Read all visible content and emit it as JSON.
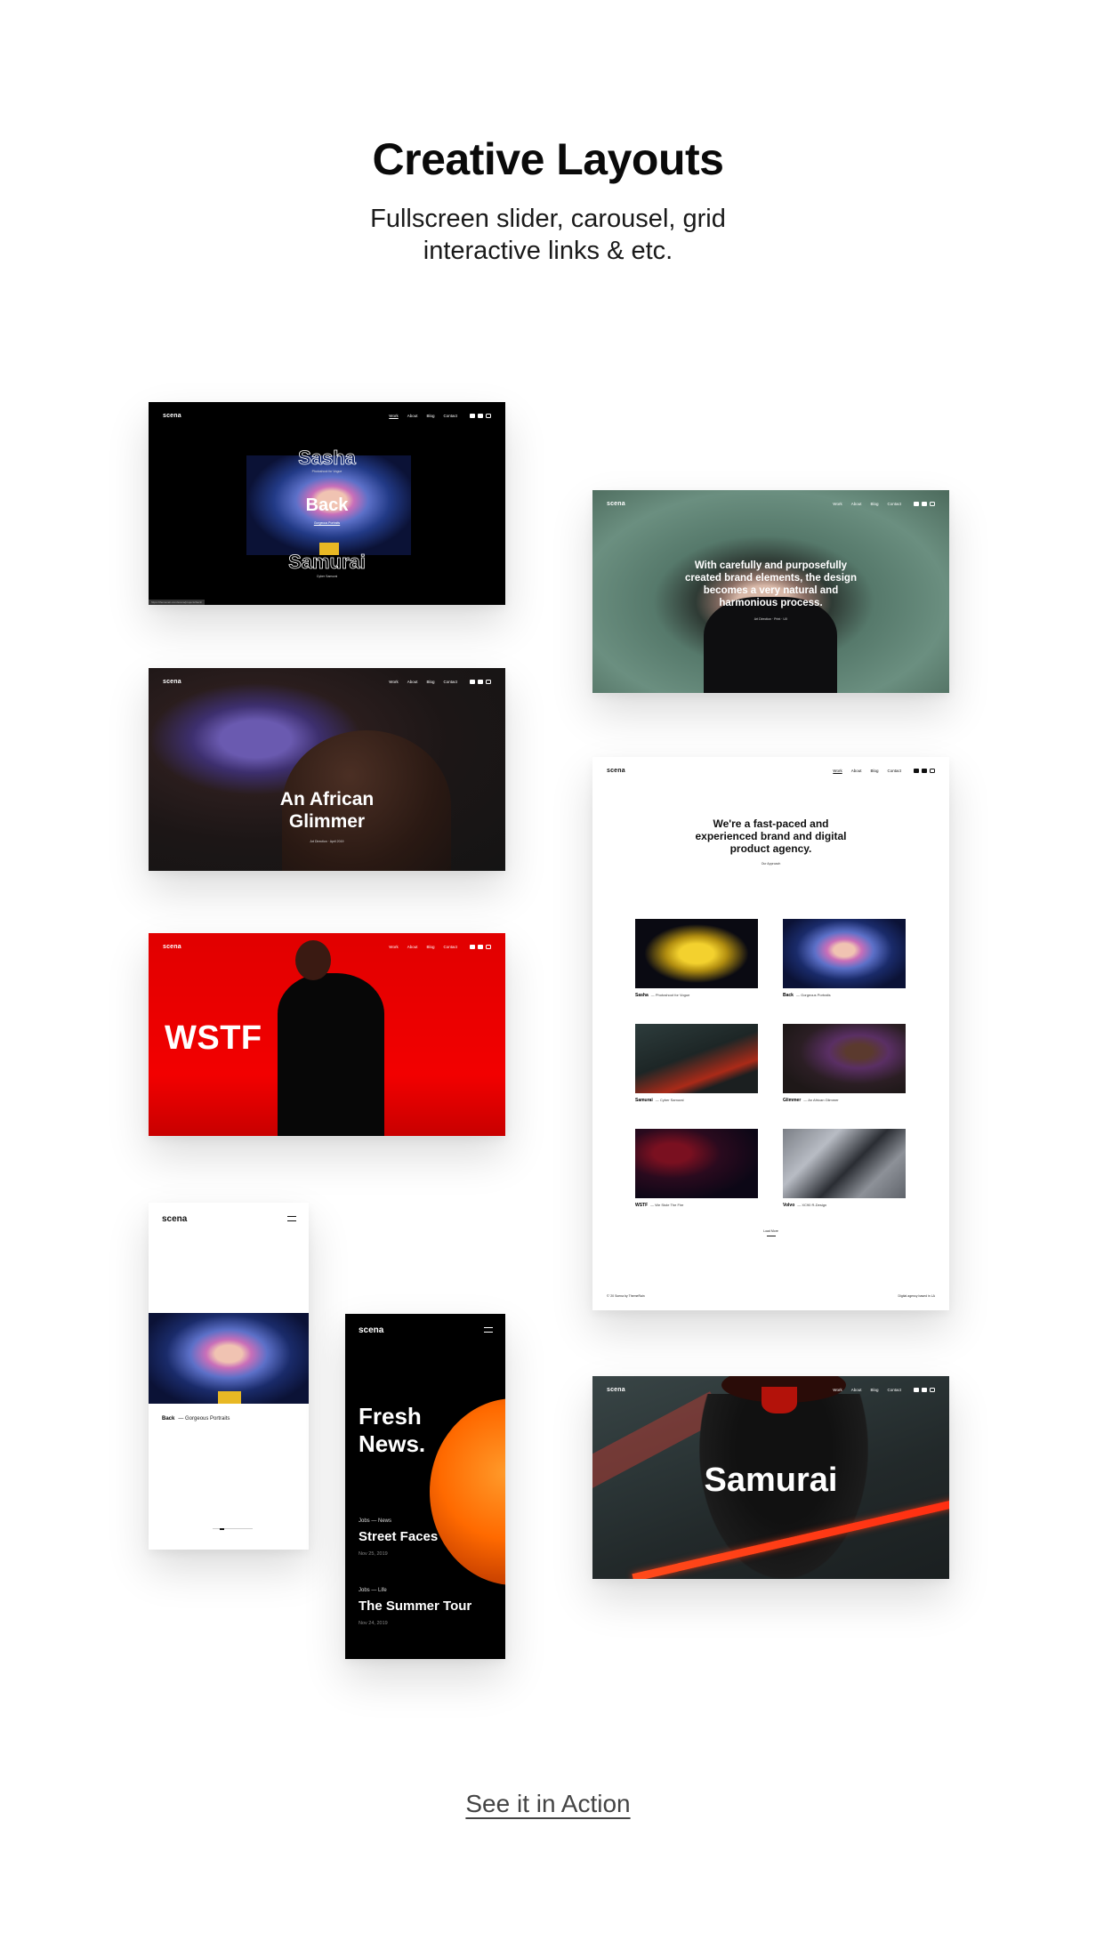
{
  "header": {
    "title": "Creative Layouts",
    "subtitle_lines": [
      "Fullscreen slider, carousel, grid",
      "interactive links & etc."
    ]
  },
  "brand": {
    "logo": "scena"
  },
  "nav": {
    "items": [
      "Work",
      "About",
      "Blog",
      "Contact"
    ],
    "social": [
      "twitter-icon",
      "youtube-icon",
      "instagram-icon"
    ]
  },
  "shots": {
    "slider": {
      "slides": [
        {
          "title": "Sasha",
          "subtitle": "Photoshoot for Vogue"
        },
        {
          "title": "Back",
          "subtitle": "Gorgeous Portraits"
        },
        {
          "title": "Samurai",
          "subtitle": "Cyber Samurai"
        }
      ],
      "status_url": "https://themerain.com/scena/projects/back/"
    },
    "quote": {
      "text": "With carefully and purposefully created brand elements, the design becomes a very natural and harmonious process.",
      "cite": "Art Direction · Print · UX"
    },
    "glimmer": {
      "title_lines": [
        "An African",
        "Glimmer"
      ],
      "meta": "Art Direction · April 2019"
    },
    "wstf": {
      "title": "WSTF"
    },
    "grid": {
      "headline": "We're a fast-paced and experienced brand and digital product agency.",
      "link": "Our Approach",
      "projects": [
        {
          "name": "Sasha",
          "desc": "Photoshoot for Vogue"
        },
        {
          "name": "Back",
          "desc": "Gorgeous Portraits"
        },
        {
          "name": "Samurai",
          "desc": "Cyber Samurai"
        },
        {
          "name": "Glimmer",
          "desc": "An African Glimmer"
        },
        {
          "name": "WSTF",
          "desc": "We Stole The Fire"
        },
        {
          "name": "Volvo",
          "desc": "XC90 R-Design"
        }
      ],
      "load_more": "Load More",
      "footer_left": "© '20 Scena by ThemeRain",
      "footer_right": "Digital agency based in LA"
    },
    "samurai": {
      "title": "Samurai"
    },
    "mobile_portfolio": {
      "project": {
        "name": "Back",
        "desc": "Gorgeous Portraits"
      }
    },
    "mobile_blog": {
      "title_lines": [
        "Fresh",
        "News."
      ],
      "posts": [
        {
          "category": "Jobs — News",
          "title": "Street Faces",
          "date": "Nov 25, 2019"
        },
        {
          "category": "Jobs — Life",
          "title": "The Summer Tour",
          "date": "Nov 24, 2019"
        }
      ]
    }
  },
  "cta": {
    "label": "See it in Action"
  }
}
